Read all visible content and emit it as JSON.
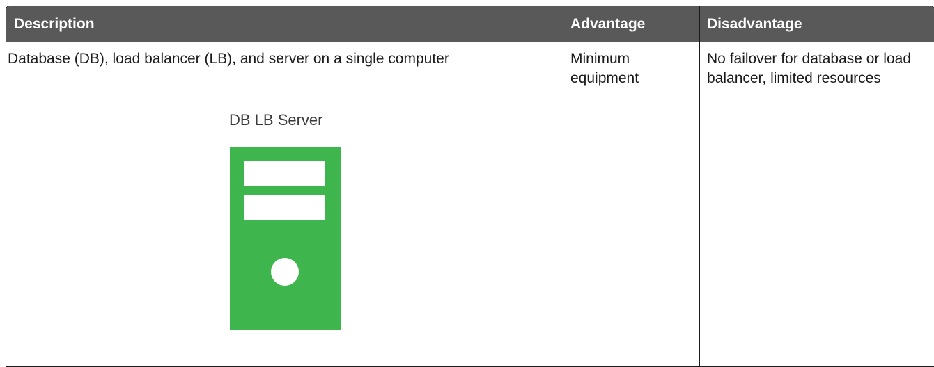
{
  "table": {
    "headers": {
      "description": "Description",
      "advantage": "Advantage",
      "disadvantage": "Disadvantage"
    },
    "rows": [
      {
        "description": "Database (DB), load balancer (LB), and server on a single computer",
        "diagram_label": "DB LB Server",
        "advantage": "Minimum equipment",
        "disadvantage": "No failover for database or load balancer, limited resources"
      }
    ]
  },
  "colors": {
    "header_background": "#595959",
    "header_text": "#ffffff",
    "server_icon": "#3fb54e"
  },
  "icons": {
    "server": "server-icon"
  }
}
